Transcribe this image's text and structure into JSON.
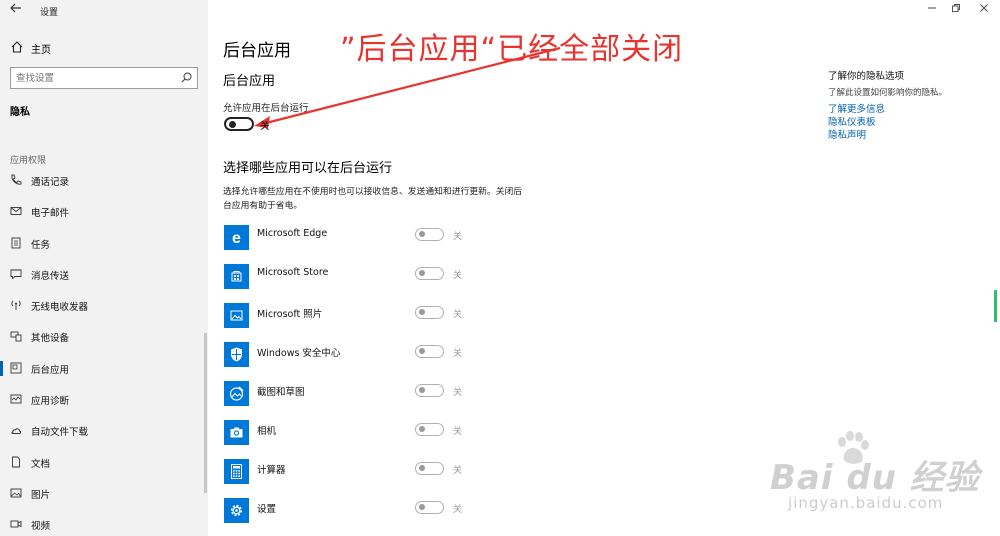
{
  "window": {
    "title": "设置"
  },
  "sidebar": {
    "home_label": "主页",
    "search_placeholder": "查找设置",
    "current_section": "隐私",
    "group_header": "应用权限",
    "items": [
      {
        "label": "通话记录",
        "icon": "phone-icon"
      },
      {
        "label": "电子邮件",
        "icon": "mail-icon"
      },
      {
        "label": "任务",
        "icon": "task-list-icon"
      },
      {
        "label": "消息传送",
        "icon": "message-icon"
      },
      {
        "label": "无线电收发器",
        "icon": "radio-icon"
      },
      {
        "label": "其他设备",
        "icon": "devices-icon"
      },
      {
        "label": "后台应用",
        "icon": "background-apps-icon",
        "active": true
      },
      {
        "label": "应用诊断",
        "icon": "diagnostics-icon"
      },
      {
        "label": "自动文件下载",
        "icon": "cloud-icon"
      },
      {
        "label": "文档",
        "icon": "document-icon"
      },
      {
        "label": "图片",
        "icon": "picture-icon"
      },
      {
        "label": "视频",
        "icon": "video-icon"
      }
    ]
  },
  "annotation": "”后台应用“已经全部关闭",
  "main": {
    "title": "后台应用",
    "subtitle": "后台应用",
    "allow_label": "允许应用在后台运行",
    "allow_toggle_label": "关",
    "choose_title": "选择哪些应用可以在后台运行",
    "description": "选择允许哪些应用在不使用时也可以接收信息、发送通知和进行更新。关闭后台应用有助于省电。",
    "apps": [
      {
        "name": "Microsoft Edge",
        "state": "关",
        "icon": "edge-icon"
      },
      {
        "name": "Microsoft Store",
        "state": "关",
        "icon": "store-icon"
      },
      {
        "name": "Microsoft 照片",
        "state": "关",
        "icon": "photos-icon"
      },
      {
        "name": "Windows 安全中心",
        "state": "关",
        "icon": "shield-icon"
      },
      {
        "name": "截图和草图",
        "state": "关",
        "icon": "snip-sketch-icon"
      },
      {
        "name": "相机",
        "state": "关",
        "icon": "camera-icon"
      },
      {
        "name": "计算器",
        "state": "关",
        "icon": "calculator-icon"
      },
      {
        "name": "设置",
        "state": "关",
        "icon": "gear-icon"
      }
    ]
  },
  "right_panel": {
    "title": "了解你的隐私选项",
    "description": "了解此设置如何影响你的隐私。",
    "links": [
      "了解更多信息",
      "隐私仪表板",
      "隐私声明"
    ]
  },
  "watermark": {
    "main": "Bai du 经验",
    "sub": "jingyan.baidu.com"
  },
  "colors": {
    "accent": "#0078d7",
    "annotation": "#e8332f",
    "sidebar_bg": "#f2f2f2"
  }
}
